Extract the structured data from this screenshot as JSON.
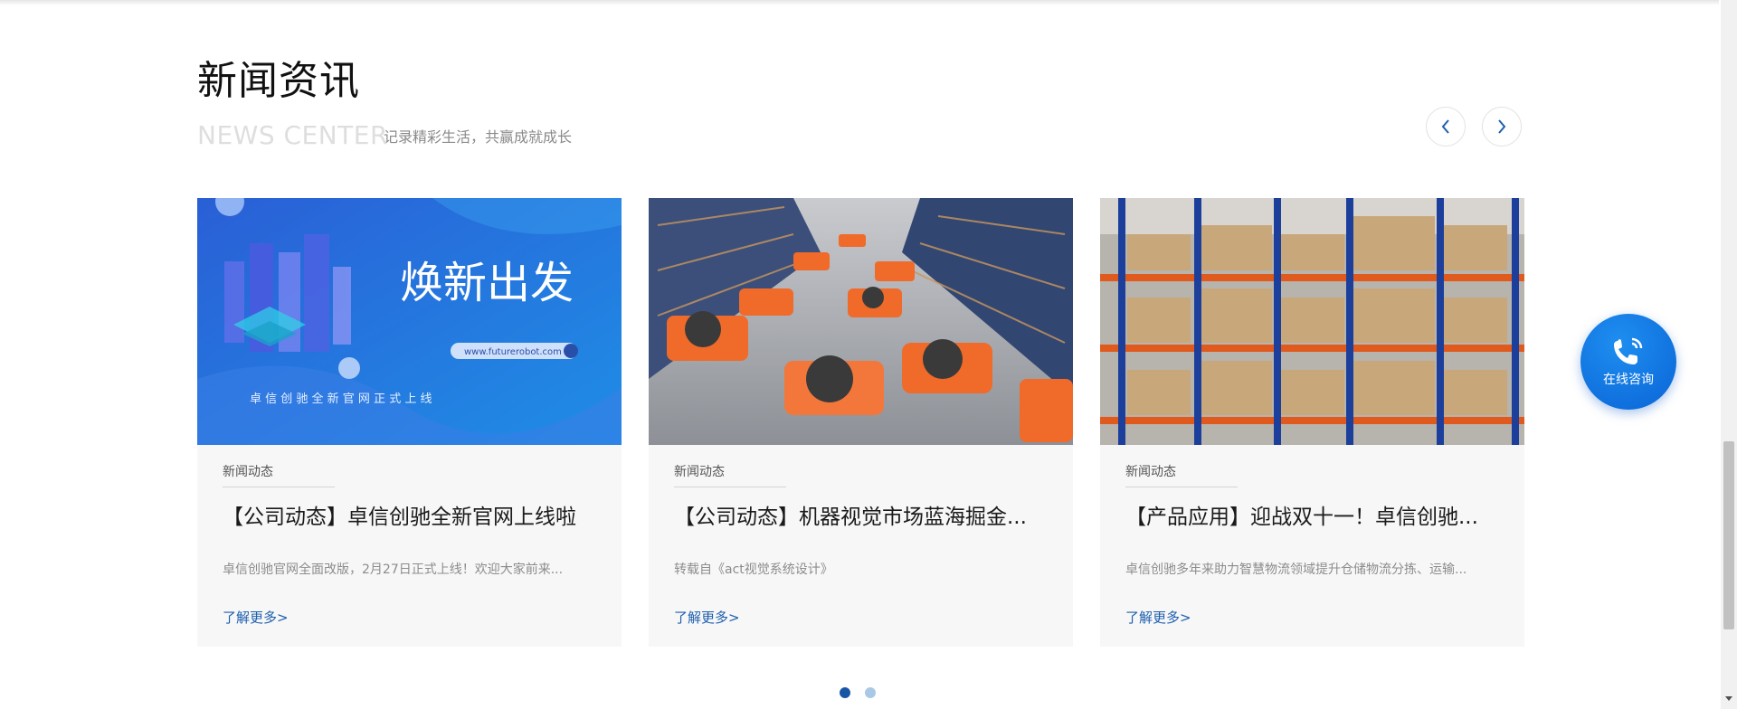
{
  "section": {
    "title": "新闻资讯",
    "en_title": "NEWS CENTER",
    "subtitle": "记录精彩生活，共赢成就成长"
  },
  "nav": {
    "prev_icon": "chevron-left-icon",
    "next_icon": "chevron-right-icon"
  },
  "cards": [
    {
      "image_title": "焕新出发",
      "image_url_text": "www.futurerobot.com",
      "image_caption": "卓 信 创 驰 全 新 官 网 正 式 上 线",
      "category": "新闻动态",
      "title": "【公司动态】卓信创驰全新官网上线啦",
      "desc": "卓信创驰官网全面改版，2月27日正式上线！欢迎大家前来...",
      "more": "了解更多>"
    },
    {
      "category": "新闻动态",
      "title": "【公司动态】机器视觉市场蓝海掘金...",
      "desc": "转载自《act视觉系统设计》",
      "more": "了解更多>"
    },
    {
      "category": "新闻动态",
      "title": "【产品应用】迎战双十一！卓信创驰...",
      "desc": "卓信创驰多年来助力智慧物流领域提升仓储物流分拣、运输...",
      "more": "了解更多>"
    }
  ],
  "pagination": {
    "total": 2,
    "active": 1
  },
  "consult": {
    "label": "在线咨询",
    "icon": "phone-icon"
  },
  "colors": {
    "accent": "#1756a5",
    "link": "#1d5fae",
    "consult_bg": "#0a64d6",
    "card_bg": "#f7f7f7"
  }
}
